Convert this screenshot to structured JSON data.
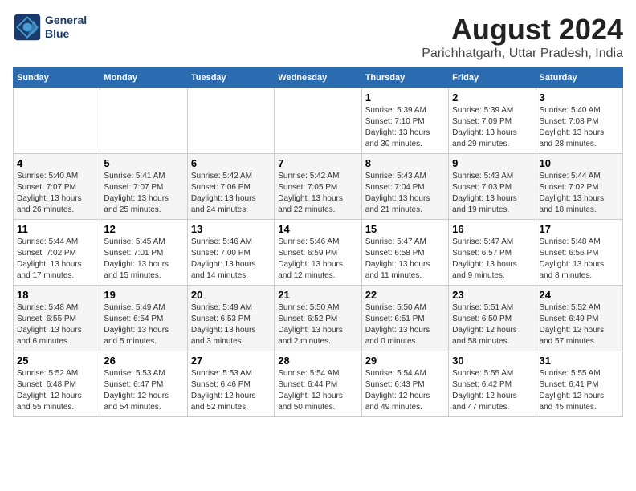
{
  "header": {
    "logo_line1": "General",
    "logo_line2": "Blue",
    "main_title": "August 2024",
    "subtitle": "Parichhatgarh, Uttar Pradesh, India"
  },
  "weekdays": [
    "Sunday",
    "Monday",
    "Tuesday",
    "Wednesday",
    "Thursday",
    "Friday",
    "Saturday"
  ],
  "weeks": [
    [
      {
        "day": "",
        "info": ""
      },
      {
        "day": "",
        "info": ""
      },
      {
        "day": "",
        "info": ""
      },
      {
        "day": "",
        "info": ""
      },
      {
        "day": "1",
        "info": "Sunrise: 5:39 AM\nSunset: 7:10 PM\nDaylight: 13 hours\nand 30 minutes."
      },
      {
        "day": "2",
        "info": "Sunrise: 5:39 AM\nSunset: 7:09 PM\nDaylight: 13 hours\nand 29 minutes."
      },
      {
        "day": "3",
        "info": "Sunrise: 5:40 AM\nSunset: 7:08 PM\nDaylight: 13 hours\nand 28 minutes."
      }
    ],
    [
      {
        "day": "4",
        "info": "Sunrise: 5:40 AM\nSunset: 7:07 PM\nDaylight: 13 hours\nand 26 minutes."
      },
      {
        "day": "5",
        "info": "Sunrise: 5:41 AM\nSunset: 7:07 PM\nDaylight: 13 hours\nand 25 minutes."
      },
      {
        "day": "6",
        "info": "Sunrise: 5:42 AM\nSunset: 7:06 PM\nDaylight: 13 hours\nand 24 minutes."
      },
      {
        "day": "7",
        "info": "Sunrise: 5:42 AM\nSunset: 7:05 PM\nDaylight: 13 hours\nand 22 minutes."
      },
      {
        "day": "8",
        "info": "Sunrise: 5:43 AM\nSunset: 7:04 PM\nDaylight: 13 hours\nand 21 minutes."
      },
      {
        "day": "9",
        "info": "Sunrise: 5:43 AM\nSunset: 7:03 PM\nDaylight: 13 hours\nand 19 minutes."
      },
      {
        "day": "10",
        "info": "Sunrise: 5:44 AM\nSunset: 7:02 PM\nDaylight: 13 hours\nand 18 minutes."
      }
    ],
    [
      {
        "day": "11",
        "info": "Sunrise: 5:44 AM\nSunset: 7:02 PM\nDaylight: 13 hours\nand 17 minutes."
      },
      {
        "day": "12",
        "info": "Sunrise: 5:45 AM\nSunset: 7:01 PM\nDaylight: 13 hours\nand 15 minutes."
      },
      {
        "day": "13",
        "info": "Sunrise: 5:46 AM\nSunset: 7:00 PM\nDaylight: 13 hours\nand 14 minutes."
      },
      {
        "day": "14",
        "info": "Sunrise: 5:46 AM\nSunset: 6:59 PM\nDaylight: 13 hours\nand 12 minutes."
      },
      {
        "day": "15",
        "info": "Sunrise: 5:47 AM\nSunset: 6:58 PM\nDaylight: 13 hours\nand 11 minutes."
      },
      {
        "day": "16",
        "info": "Sunrise: 5:47 AM\nSunset: 6:57 PM\nDaylight: 13 hours\nand 9 minutes."
      },
      {
        "day": "17",
        "info": "Sunrise: 5:48 AM\nSunset: 6:56 PM\nDaylight: 13 hours\nand 8 minutes."
      }
    ],
    [
      {
        "day": "18",
        "info": "Sunrise: 5:48 AM\nSunset: 6:55 PM\nDaylight: 13 hours\nand 6 minutes."
      },
      {
        "day": "19",
        "info": "Sunrise: 5:49 AM\nSunset: 6:54 PM\nDaylight: 13 hours\nand 5 minutes."
      },
      {
        "day": "20",
        "info": "Sunrise: 5:49 AM\nSunset: 6:53 PM\nDaylight: 13 hours\nand 3 minutes."
      },
      {
        "day": "21",
        "info": "Sunrise: 5:50 AM\nSunset: 6:52 PM\nDaylight: 13 hours\nand 2 minutes."
      },
      {
        "day": "22",
        "info": "Sunrise: 5:50 AM\nSunset: 6:51 PM\nDaylight: 13 hours\nand 0 minutes."
      },
      {
        "day": "23",
        "info": "Sunrise: 5:51 AM\nSunset: 6:50 PM\nDaylight: 12 hours\nand 58 minutes."
      },
      {
        "day": "24",
        "info": "Sunrise: 5:52 AM\nSunset: 6:49 PM\nDaylight: 12 hours\nand 57 minutes."
      }
    ],
    [
      {
        "day": "25",
        "info": "Sunrise: 5:52 AM\nSunset: 6:48 PM\nDaylight: 12 hours\nand 55 minutes."
      },
      {
        "day": "26",
        "info": "Sunrise: 5:53 AM\nSunset: 6:47 PM\nDaylight: 12 hours\nand 54 minutes."
      },
      {
        "day": "27",
        "info": "Sunrise: 5:53 AM\nSunset: 6:46 PM\nDaylight: 12 hours\nand 52 minutes."
      },
      {
        "day": "28",
        "info": "Sunrise: 5:54 AM\nSunset: 6:44 PM\nDaylight: 12 hours\nand 50 minutes."
      },
      {
        "day": "29",
        "info": "Sunrise: 5:54 AM\nSunset: 6:43 PM\nDaylight: 12 hours\nand 49 minutes."
      },
      {
        "day": "30",
        "info": "Sunrise: 5:55 AM\nSunset: 6:42 PM\nDaylight: 12 hours\nand 47 minutes."
      },
      {
        "day": "31",
        "info": "Sunrise: 5:55 AM\nSunset: 6:41 PM\nDaylight: 12 hours\nand 45 minutes."
      }
    ]
  ]
}
